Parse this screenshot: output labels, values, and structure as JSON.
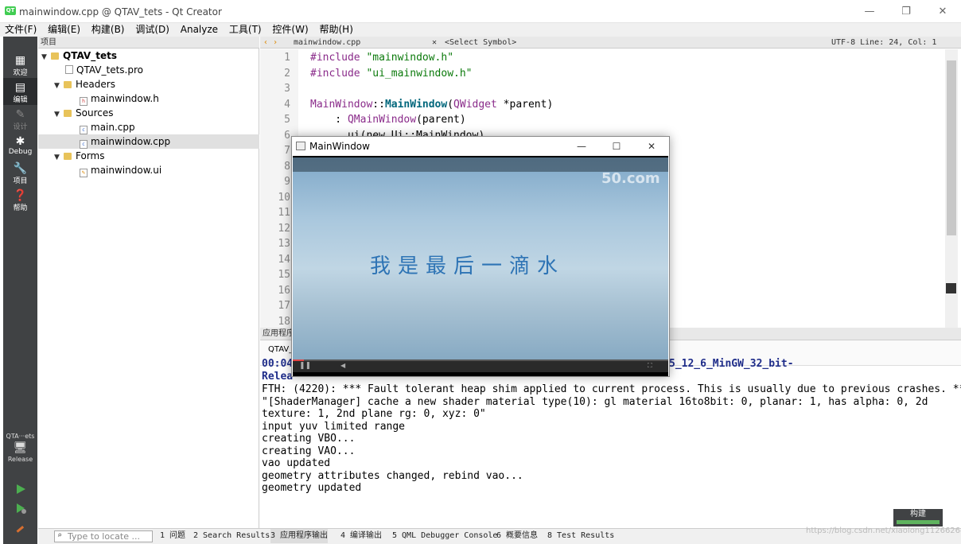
{
  "window": {
    "title": "mainwindow.cpp @ QTAV_tets - Qt Creator",
    "logo": "QT",
    "min": "—",
    "max": "❐",
    "close": "✕"
  },
  "menu": [
    "文件(F)",
    "编辑(E)",
    "构建(B)",
    "调试(D)",
    "Analyze",
    "工具(T)",
    "控件(W)",
    "帮助(H)"
  ],
  "modes": [
    {
      "label": "欢迎",
      "icon": "grid-icon"
    },
    {
      "label": "编辑",
      "icon": "edit-icon"
    },
    {
      "label": "设计",
      "icon": "design-icon"
    },
    {
      "label": "Debug",
      "icon": "bug-icon"
    },
    {
      "label": "项目",
      "icon": "wrench-icon"
    },
    {
      "label": "帮助",
      "icon": "help-icon"
    }
  ],
  "kit": {
    "project": "QTA···ets",
    "config": "Release"
  },
  "project_panel": {
    "header": "项目",
    "tree": {
      "root": "QTAV_tets",
      "pro": "QTAV_tets.pro",
      "headers": "Headers",
      "header_file": "mainwindow.h",
      "sources": "Sources",
      "source_files": [
        "main.cpp",
        "mainwindow.cpp"
      ],
      "forms": "Forms",
      "form_file": "mainwindow.ui"
    }
  },
  "editor": {
    "file": "mainwindow.cpp",
    "symbol": "<Select Symbol>",
    "encoding_pos": "UTF-8 Line: 24, Col: 1",
    "line_numbers": [
      "1",
      "2",
      "3",
      "4",
      "5",
      "6",
      "7",
      "8",
      "9",
      "10",
      "11",
      "12",
      "13",
      "14",
      "15",
      "16",
      "17",
      "18"
    ],
    "lines": {
      "l1_a": "#include ",
      "l1_b": "\"mainwindow.h\"",
      "l2_a": "#include ",
      "l2_b": "\"ui_mainwindow.h\"",
      "l4_a": "MainWindow",
      "l4_b": "::",
      "l4_c": "MainWindow",
      "l4_d": "(",
      "l4_e": "QWidget",
      "l4_f": " *parent)",
      "l5_a": "    : ",
      "l5_b": "QMainWindow",
      "l5_c": "(parent)",
      "l6_a": "      ui(new Ui::MainWindow)"
    }
  },
  "output_panel": {
    "header": "应用程序输出",
    "tab": "QTAV_tets",
    "lines": [
      {
        "text": "00:04",
        "suffix": "5_12_6_MinGW_32_bit-",
        "blue": true
      },
      {
        "text": "Relea",
        "suffix": "",
        "blue": true
      },
      {
        "text": "FTH: (4220): *** Fault tolerant heap shim applied to current process. This is usually due to previous crashes. ***",
        "blue": false
      },
      {
        "text": "\"[ShaderManager] cache a new shader material type(10): gl material 16to8bit: 0, planar: 1, has alpha: 0, 2d",
        "blue": false
      },
      {
        "text": "texture: 1, 2nd plane rg: 0, xyz: 0\"",
        "blue": false
      },
      {
        "text": "input yuv limited range",
        "blue": false
      },
      {
        "text": "creating VBO...",
        "blue": false
      },
      {
        "text": "creating VAO...",
        "blue": false
      },
      {
        "text": "vao updated",
        "blue": false
      },
      {
        "text": "geometry attributes changed, rebind vao...",
        "blue": false
      },
      {
        "text": "geometry updated",
        "blue": false
      }
    ]
  },
  "build_button": "构建",
  "statusbar": {
    "locate_placeholder": "Type to locate ...",
    "tabs": [
      "1 问题",
      "2 Search Results",
      "3 应用程序输出",
      "4 编译输出",
      "5 QML Debugger Console",
      "6 概要信息",
      "8 Test Results"
    ]
  },
  "watermark": "https://blog.csdn.net/xiaolong1126626497",
  "main_window": {
    "title": "MainWindow",
    "min": "—",
    "max": "☐",
    "close": "✕",
    "video": {
      "subtitle": "我是最后一滴水",
      "logo": "50.com",
      "progress": 0.03
    }
  },
  "colors": {
    "sidebar": "#404244",
    "keyword": "#8a2b8a",
    "string": "#0b7a0b",
    "function": "#00677c",
    "subtitle": "#2e74b5"
  }
}
